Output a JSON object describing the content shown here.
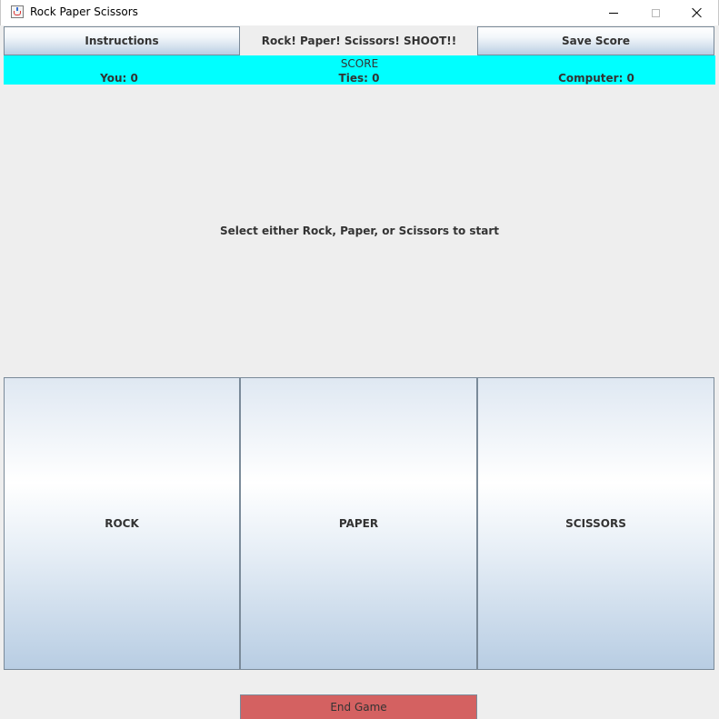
{
  "window": {
    "title": "Rock Paper Scissors"
  },
  "toolbar": {
    "instructions_label": "Instructions",
    "heading": "Rock! Paper! Scissors! SHOOT!!",
    "save_label": "Save Score"
  },
  "score": {
    "title": "SCORE",
    "you": "You: 0",
    "ties": "Ties: 0",
    "computer": "Computer: 0",
    "background_color": "#00ffff"
  },
  "message": "Select either Rock, Paper, or Scissors to start",
  "choices": {
    "rock": "ROCK",
    "paper": "PAPER",
    "scissors": "SCISSORS"
  },
  "end_game_label": "End Game",
  "colors": {
    "end_game": "#d46161"
  }
}
